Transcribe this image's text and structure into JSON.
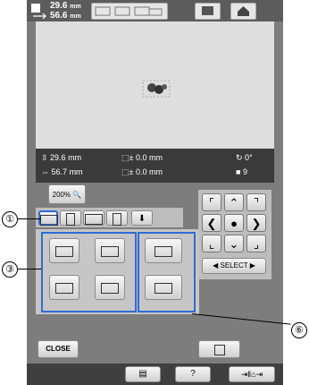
{
  "size": {
    "width": "29.6",
    "height": "56.6",
    "unit": "mm"
  },
  "info": {
    "h": "29.6",
    "v": "56.7",
    "unit": "mm",
    "dx": "0.0",
    "dy": "0.0",
    "angle": "0°",
    "colors": "9"
  },
  "zoom": "200%",
  "close": "CLOSE",
  "select": "SELECT",
  "callouts": [
    "①",
    "③",
    "⑥"
  ]
}
